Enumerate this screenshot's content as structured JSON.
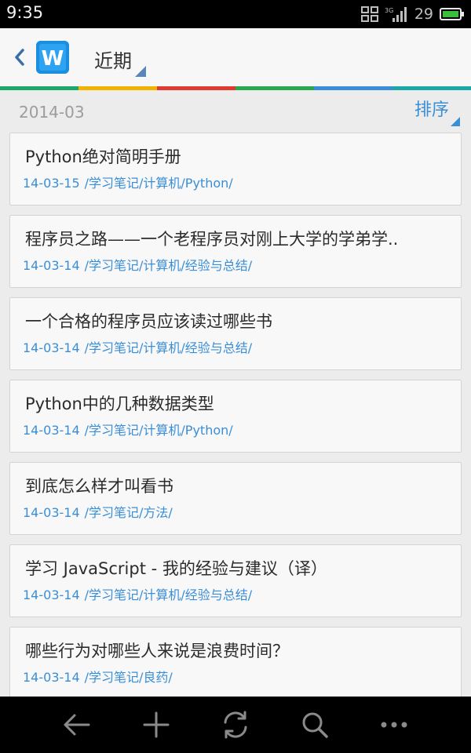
{
  "status_bar": {
    "time": "9:35",
    "network": "3G",
    "battery_level": "29",
    "icons": [
      "screenshot-icon",
      "signal-icon",
      "battery-icon"
    ]
  },
  "header": {
    "back_icon": "chevron-left-icon",
    "app_logo_letter": "W",
    "title": "近期"
  },
  "accent_stripe": [
    "#1da86a",
    "#f2b300",
    "#dd3b2f",
    "#2aa84f",
    "#3c8ed8",
    "#1ea7a6"
  ],
  "section": {
    "date": "2014-03",
    "sort_label": "排序"
  },
  "notes": [
    {
      "title": "Python绝对简明手册",
      "date": "14-03-15",
      "path": "/学习笔记/计算机/Python/"
    },
    {
      "title": "程序员之路——一个老程序员对刚上大学的学弟学..",
      "date": "14-03-14",
      "path": "/学习笔记/计算机/经验与总结/"
    },
    {
      "title": "一个合格的程序员应该读过哪些书",
      "date": "14-03-14",
      "path": "/学习笔记/计算机/经验与总结/"
    },
    {
      "title": "Python中的几种数据类型",
      "date": "14-03-14",
      "path": "/学习笔记/计算机/Python/"
    },
    {
      "title": "到底怎么样才叫看书",
      "date": "14-03-14",
      "path": "/学习笔记/方法/"
    },
    {
      "title": "学习 JavaScript - 我的经验与建议（译）",
      "date": "14-03-14",
      "path": "/学习笔记/计算机/经验与总结/"
    },
    {
      "title": "哪些行为对哪些人来说是浪费时间？",
      "date": "14-03-14",
      "path": "/学习笔记/良药/"
    }
  ],
  "bottom_nav": [
    "back-arrow-icon",
    "add-icon",
    "sync-icon",
    "search-icon",
    "more-icon"
  ],
  "colors": {
    "accent_blue": "#3a8ed6",
    "logo_blue": "#1a8fe0",
    "background": "#ececec"
  }
}
